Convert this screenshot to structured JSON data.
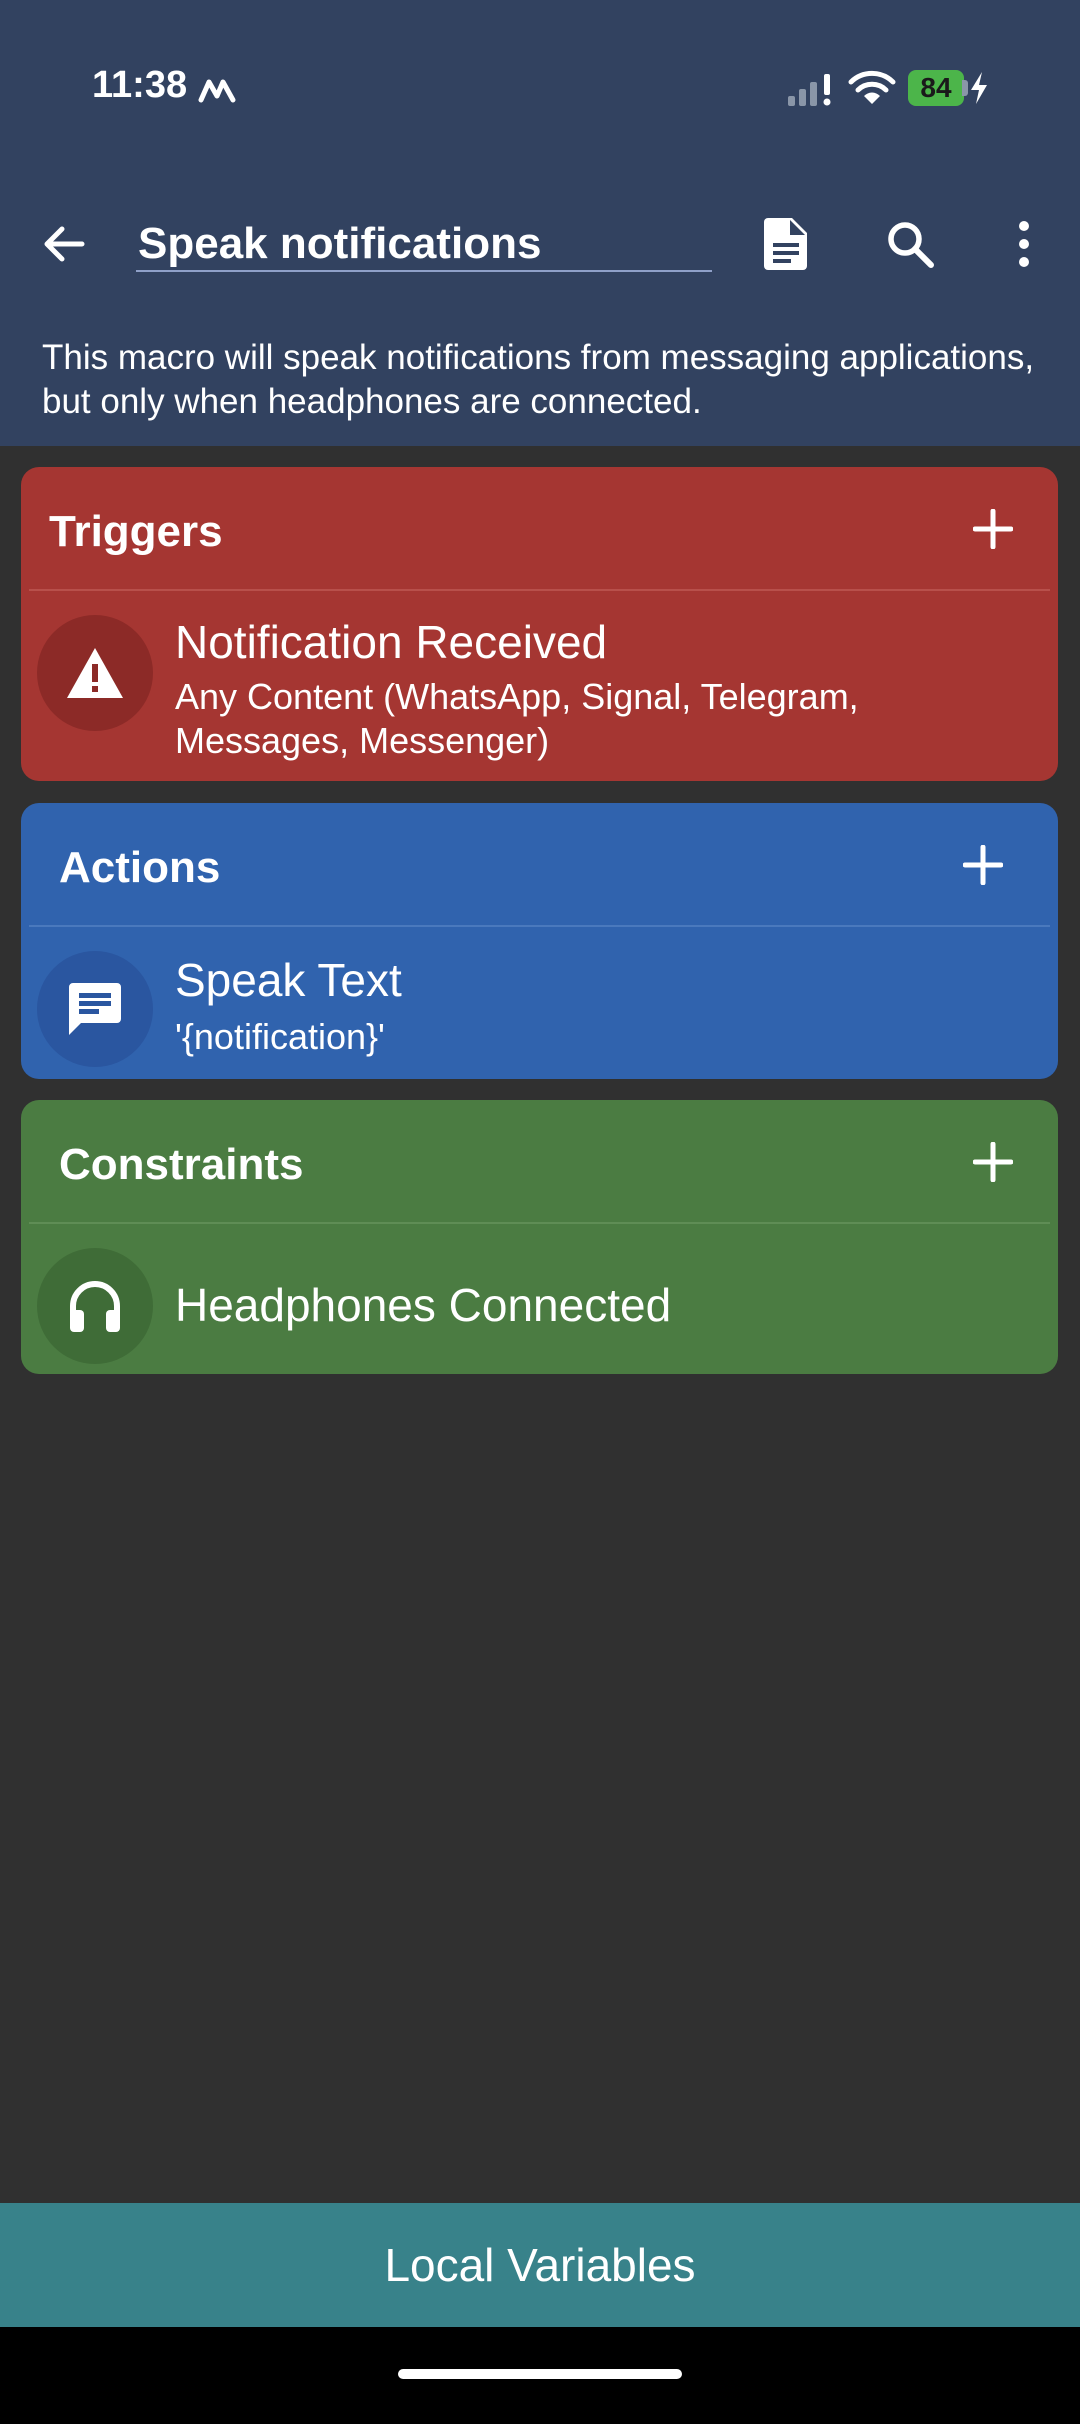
{
  "status_bar": {
    "time": "11:38",
    "battery_level": "84"
  },
  "toolbar": {
    "title": "Speak notifications"
  },
  "description": "This macro will speak notifications from messaging applications, but only when headphones are connected.",
  "triggers": {
    "title": "Triggers",
    "items": [
      {
        "title": "Notification Received",
        "subtitle": "Any Content (WhatsApp, Signal, Telegram, Messages, Messenger)",
        "icon": "warning-icon"
      }
    ]
  },
  "actions": {
    "title": "Actions",
    "items": [
      {
        "title": "Speak Text",
        "subtitle": "'{notification}'",
        "icon": "chat-message-icon"
      }
    ]
  },
  "constraints": {
    "title": "Constraints",
    "items": [
      {
        "title": "Headphones Connected",
        "icon": "headphones-icon"
      }
    ]
  },
  "bottom_bar": {
    "label": "Local Variables"
  },
  "colors": {
    "header": "#324260",
    "triggers": "#a53632",
    "actions": "#3063ae",
    "constraints": "#4b7c42",
    "bottom_bar": "#38828a",
    "background": "#303030"
  }
}
